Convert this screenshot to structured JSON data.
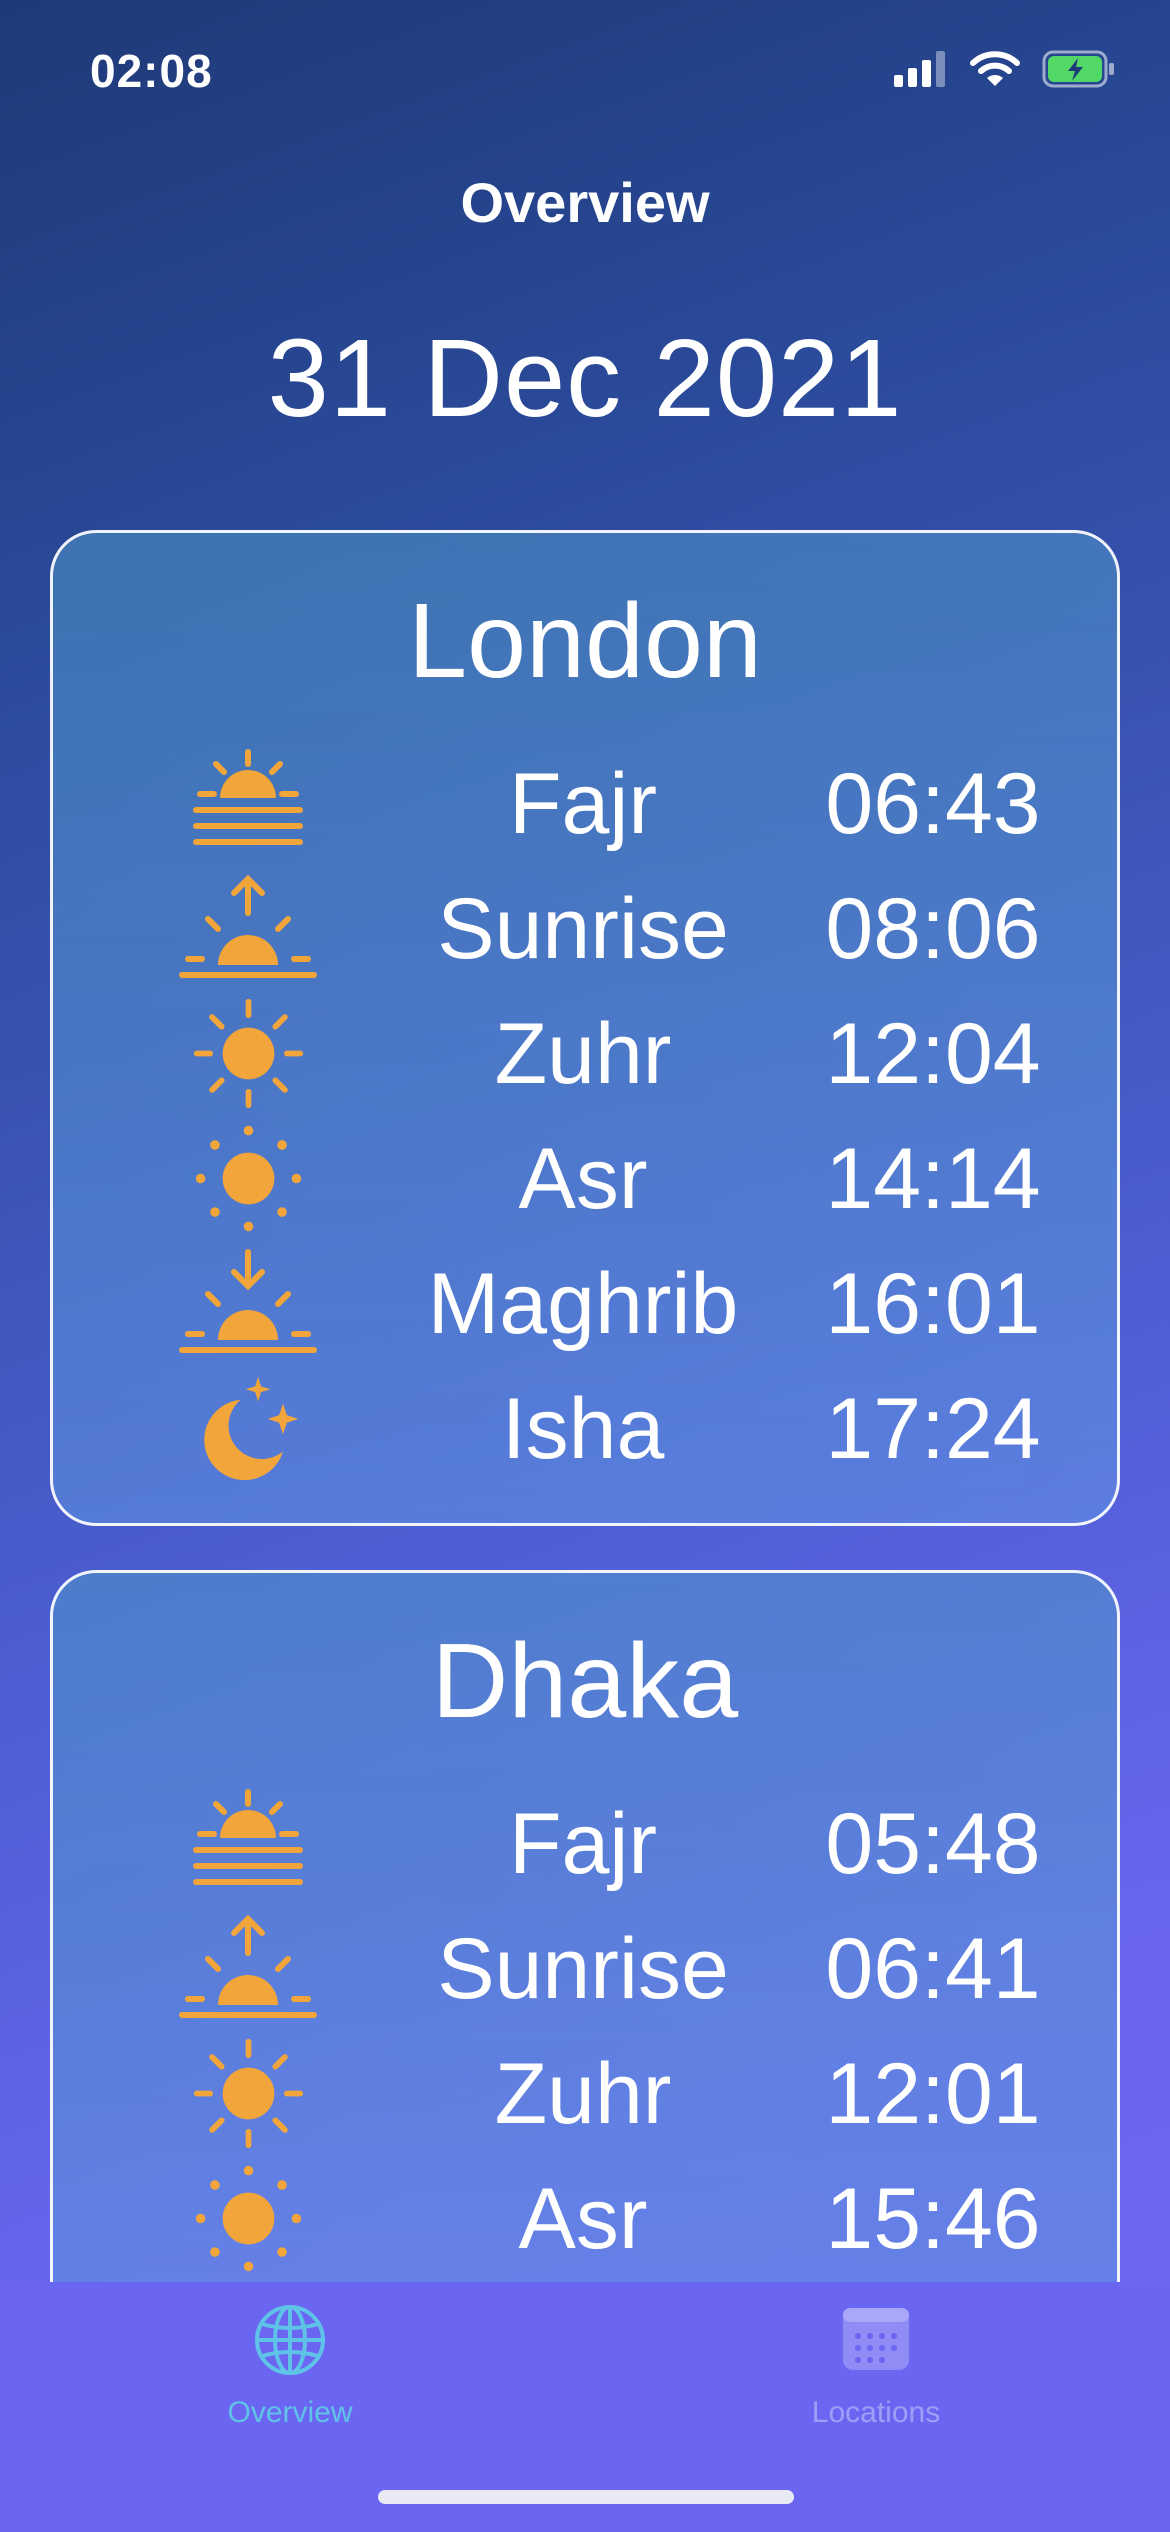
{
  "status_bar": {
    "time": "02:08",
    "icons": [
      "cellular-signal-icon",
      "wifi-icon",
      "battery-charging-icon"
    ]
  },
  "header": {
    "title": "Overview",
    "date": "31 Dec 2021"
  },
  "colors": {
    "accent_icon": "#F2A53A",
    "tab_active": "#5FC3E8",
    "tab_inactive": "#9F9EF7",
    "tab_bar": "#6B66F2"
  },
  "cities": [
    {
      "name": "London",
      "prayers": [
        {
          "name": "Fajr",
          "time": "06:43",
          "icon": "fajr-icon"
        },
        {
          "name": "Sunrise",
          "time": "08:06",
          "icon": "sunrise-icon"
        },
        {
          "name": "Zuhr",
          "time": "12:04",
          "icon": "sun-icon"
        },
        {
          "name": "Asr",
          "time": "14:14",
          "icon": "sun-dotted-icon"
        },
        {
          "name": "Maghrib",
          "time": "16:01",
          "icon": "sunset-icon"
        },
        {
          "name": "Isha",
          "time": "17:24",
          "icon": "moon-stars-icon"
        }
      ]
    },
    {
      "name": "Dhaka",
      "prayers": [
        {
          "name": "Fajr",
          "time": "05:48",
          "icon": "fajr-icon"
        },
        {
          "name": "Sunrise",
          "time": "06:41",
          "icon": "sunrise-icon"
        },
        {
          "name": "Zuhr",
          "time": "12:01",
          "icon": "sun-icon"
        },
        {
          "name": "Asr",
          "time": "15:46",
          "icon": "sun-dotted-icon"
        }
      ]
    }
  ],
  "tab_bar": {
    "tabs": [
      {
        "label": "Overview",
        "icon": "globe-icon",
        "active": true
      },
      {
        "label": "Locations",
        "icon": "calendar-icon",
        "active": false
      }
    ]
  }
}
